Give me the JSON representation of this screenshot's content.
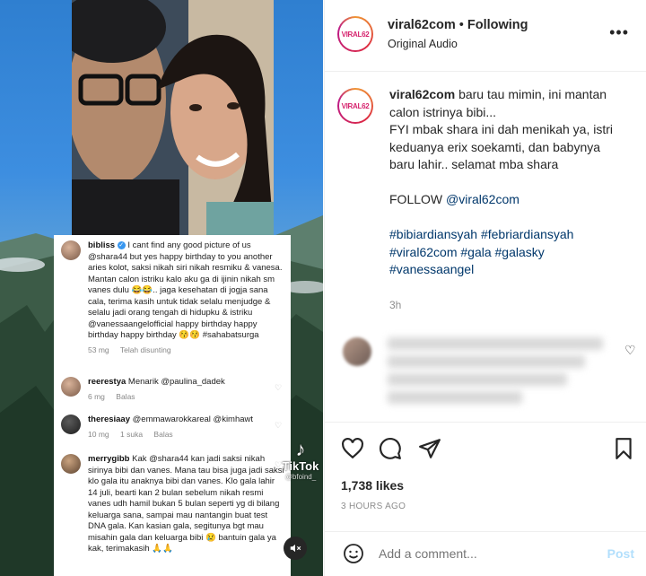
{
  "header": {
    "avatar_text": "VIRAL62",
    "username": "viral62com",
    "dot": "•",
    "following": "Following",
    "audio": "Original Audio",
    "more": "•••"
  },
  "caption": {
    "avatar_text": "VIRAL62",
    "username": "viral62com",
    "lines": [
      "baru tau mimin, ini mantan",
      "calon istrinya bibi...",
      "FYI mbak shara ini dah menikah ya, istri",
      "keduanya erix soekamti, dan babynya",
      "baru lahir.. selamat mba shara"
    ],
    "follow_prefix": "FOLLOW ",
    "follow_mention": "@viral62com",
    "hashtags_line1": "#bibiardiansyah #febriardiansyah",
    "hashtags_line2": "#viral62com #gala #galasky",
    "hashtags_line3": "#vanessaangel",
    "time": "3h"
  },
  "video": {
    "tiktok_label": "TikTok",
    "tiktok_sub": "@bfoind_",
    "comments": [
      {
        "user": "bibliss",
        "verified": true,
        "text": "I cant find any good picture of us @shara44 but yes happy birthday to you another aries kolot, saksi nikah siri nikah resmiku & vanesa. Mantan calon istriku kalo aku ga di ijinin nikah sm vanes dulu 😂😂.. jaga kesehatan di jogja sana cala, terima kasih untuk tidak selalu menjudge & selalu jadi orang tengah di hidupku & istriku @vanessaangelofficial happy birthday happy birthday happy birthday 😚😚 #sahabatsurga",
        "meta1": "53 mg",
        "meta2": "Telah disunting",
        "meta3": ""
      },
      {
        "user": "reerestya",
        "text": "Menarik @paulina_dadek",
        "meta1": "6 mg",
        "meta2": "Balas",
        "meta3": ""
      },
      {
        "user": "theresiaay",
        "text": "@emmawarokkareal @kimhawt",
        "meta1": "10 mg",
        "meta2": "1 suka",
        "meta3": "Balas"
      },
      {
        "user": "merrygibb",
        "text": "Kak @shara44 kan jadi saksi nikah sirinya bibi dan vanes. Mana tau bisa juga jadi saksi klo gala itu anaknya bibi dan vanes. Klo gala lahir 14 juli, bearti kan 2 bulan sebelum nikah resmi vanes udh hamil bukan 5 bulan seperti yg di bilang keluarga sana, sampai mau nantangin buat test DNA gala. Kan kasian gala, segitunya bgt mau misahin gala dan keluarga bibi 😢 bantuin gala ya kak, terimakasih 🙏🙏",
        "meta1": "",
        "meta2": "",
        "meta3": ""
      }
    ]
  },
  "actions": {
    "likes": "1,738 likes",
    "time": "3 HOURS AGO"
  },
  "add_comment": {
    "placeholder": "Add a comment...",
    "post": "Post"
  }
}
